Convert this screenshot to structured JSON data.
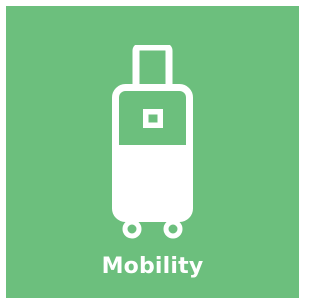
{
  "tile": {
    "label": "Mobility",
    "icon": "suitcase-icon",
    "background_color": "#6cbf7d",
    "foreground_color": "#ffffff"
  }
}
